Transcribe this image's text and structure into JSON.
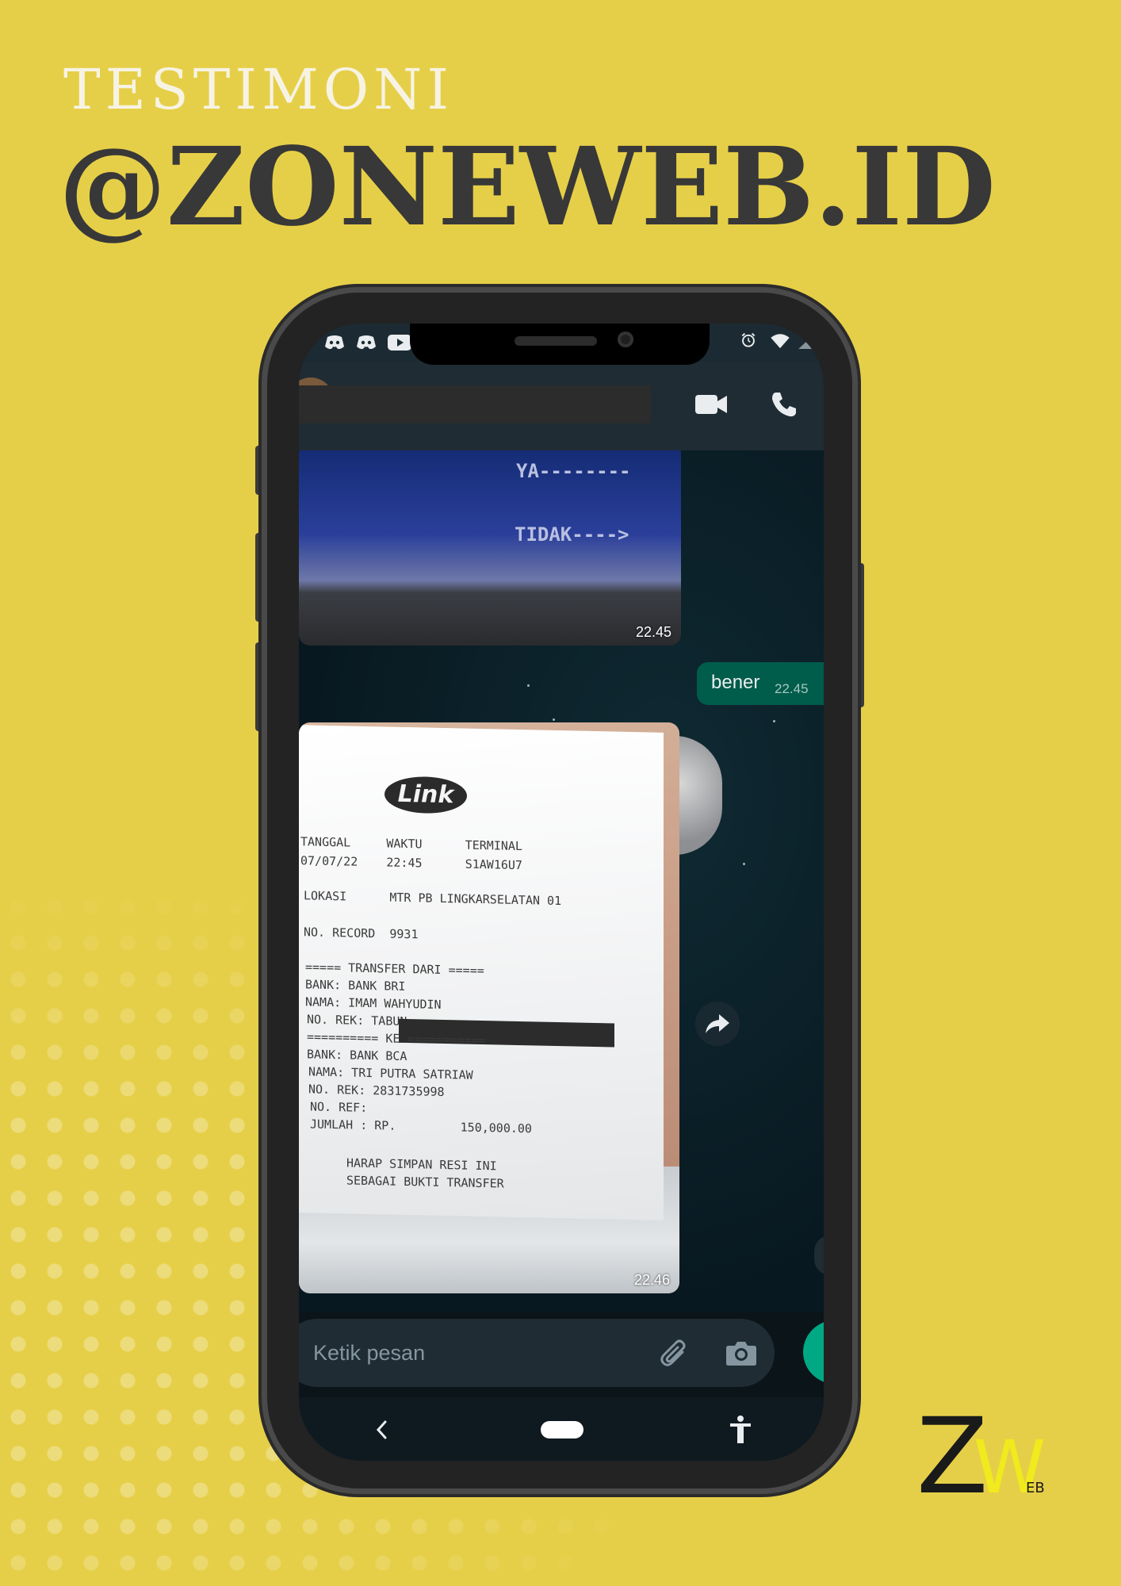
{
  "headline": {
    "small": "TESTIMONI",
    "big": "@ZONEWEB.ID"
  },
  "chat": {
    "header_icons": [
      "video-call-icon",
      "voice-call-icon"
    ],
    "atm_image": {
      "text_yes": "YA--------",
      "text_no": "TIDAK---->",
      "time": "22.45"
    },
    "outgoing": {
      "text": "bener",
      "time": "22.45"
    },
    "receipt_image": {
      "logo": "Link",
      "time": "22.46",
      "lines": [
        "TANGGAL     WAKTU      TERMINAL",
        "07/07/22    22:45      S1AW16U7",
        "LOKASI      MTR PB LINGKARSELATAN 01",
        "NO. RECORD  9931",
        "===== TRANSFER DARI =====",
        "BANK: BANK BRI",
        "NAMA: IMAM WAHYUDIN",
        "NO. REK: TABUN",
        "========== KE ===========",
        "BANK: BANK BCA",
        "NAMA: TRI PUTRA SATRIAW",
        "NO. REK: 2831735998",
        "NO. REF:",
        "JUMLAH : RP.         150,000.00",
        "HARAP SIMPAN RESI INI",
        "SEBAGAI BUKTI TRANSFER"
      ]
    },
    "input_placeholder": "Ketik pesan"
  },
  "logo": {
    "main": "ZW",
    "suffix": "EB"
  },
  "colors": {
    "background": "#e6cf48",
    "heading_dark": "#383838",
    "accent_green": "#00a884",
    "logo_yellow": "#f1ea1d"
  }
}
